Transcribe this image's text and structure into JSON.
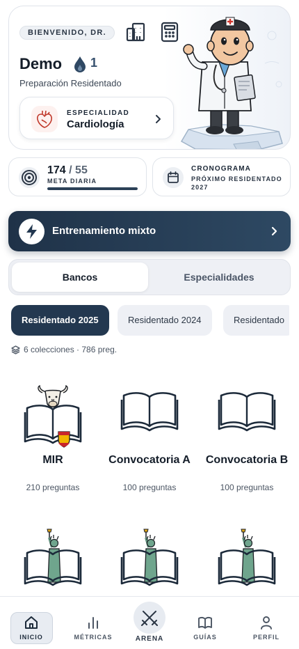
{
  "header": {
    "welcome": "BIENVENIDO, DR.",
    "user_name": "Demo",
    "streak": "1",
    "subtitle": "Preparación Residentado",
    "specialty_label": "ESPECIALIDAD",
    "specialty_value": "Cardiología"
  },
  "stats": {
    "goal_done": "174",
    "goal_total": "/ 55",
    "goal_label": "META DIARIA",
    "goal_progress": 1.0,
    "schedule_title": "CRONOGRAMA",
    "schedule_subtitle": "PRÓXIMO RESIDENTADO 2027"
  },
  "mixed_training": {
    "label": "Entrenamiento mixto"
  },
  "segments": {
    "active": "Bancos",
    "inactive": "Especialidades"
  },
  "chips": [
    "Residentado 2025",
    "Residentado 2024",
    "Residentado"
  ],
  "collections_meta": "6 colecciones · 786 preg.",
  "banks": [
    {
      "title": "MIR",
      "count": "210 preguntas"
    },
    {
      "title": "Convocatoria A",
      "count": "100 preguntas"
    },
    {
      "title": "Convocatoria B",
      "count": "100 preguntas"
    }
  ],
  "nav": {
    "home": "INICIO",
    "metrics": "MÉTRICAS",
    "arena": "ARENA",
    "guides": "GUÍAS",
    "profile": "PERFIL"
  },
  "colors": {
    "primary_dark": "#233850",
    "accent_red": "#c0392b",
    "background": "#ffffff"
  },
  "icons": [
    "hospital-icon",
    "calculator-icon",
    "drop-icon",
    "heart-icon",
    "chevron-right-icon",
    "target-icon",
    "calendar-icon",
    "bolt-icon",
    "layers-icon",
    "book-icon",
    "home-icon",
    "bar-chart-icon",
    "swords-icon",
    "open-book-icon",
    "user-icon"
  ]
}
